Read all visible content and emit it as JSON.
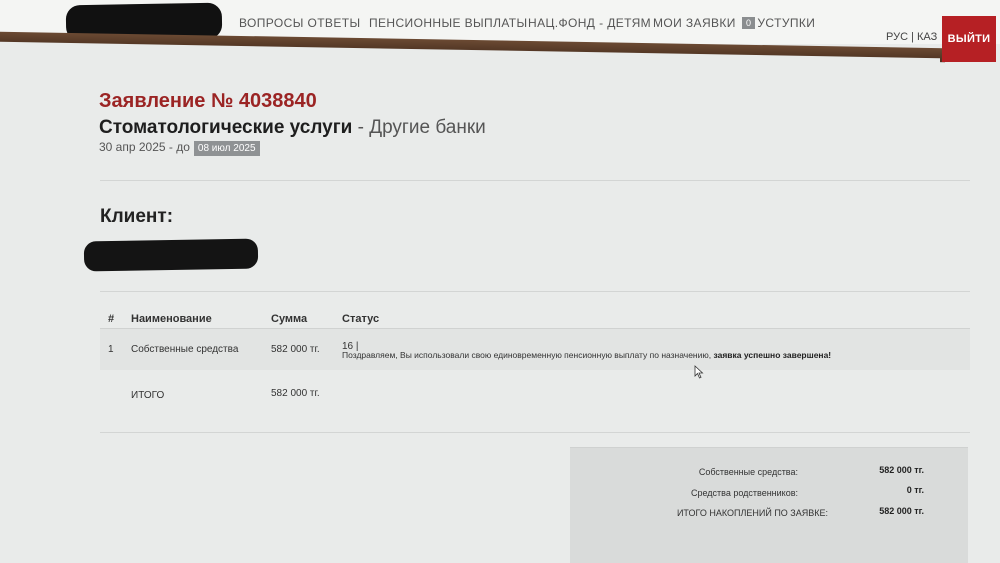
{
  "nav": {
    "items": [
      "ВОПРОСЫ ОТВЕТЫ",
      "ПЕНСИОННЫЕ ВЫПЛАТЫ",
      "НАЦ.ФОНД - ДЕТЯМ",
      "МОИ ЗАЯВКИ"
    ],
    "concessions_badge": "0",
    "concessions_label": "УСТУПКИ",
    "lang": "РУС | КАЗ",
    "logout": "ВЫЙТИ"
  },
  "application": {
    "title": "Заявление № 4038840",
    "service_name": "Стоматологические услуги",
    "service_separator": " - ",
    "bank": "Другие банки",
    "date_from": "30 апр 2025 - до",
    "date_to": "08 июл 2025"
  },
  "client": {
    "label": "Клиент:"
  },
  "table": {
    "headers": [
      "#",
      "Наименование",
      "Сумма",
      "Статус"
    ],
    "rows": [
      {
        "num": "1",
        "name": "Собственные средства",
        "amount": "582 000 тг.",
        "status_code": "16 |",
        "status_msg": "Поздравляем, Вы использовали свою единовременную пенсионную выплату по назначению,",
        "status_msg_bold": "заявка успешно завершена!"
      }
    ],
    "total_label": "ИТОГО",
    "total_amount": "582 000 тг."
  },
  "summary": {
    "own_label": "Собственные средства:",
    "own_value": "582 000 тг.",
    "relatives_label": "Средства родственников:",
    "relatives_value": "0 тг.",
    "total_label": "ИТОГО НАКОПЛЕНИЙ ПО ЗАЯВКЕ:",
    "total_value": "582 000 тг."
  },
  "colors": {
    "accent_red": "#b62024",
    "title_red": "#9b2424",
    "brown": "#5a3a26"
  }
}
